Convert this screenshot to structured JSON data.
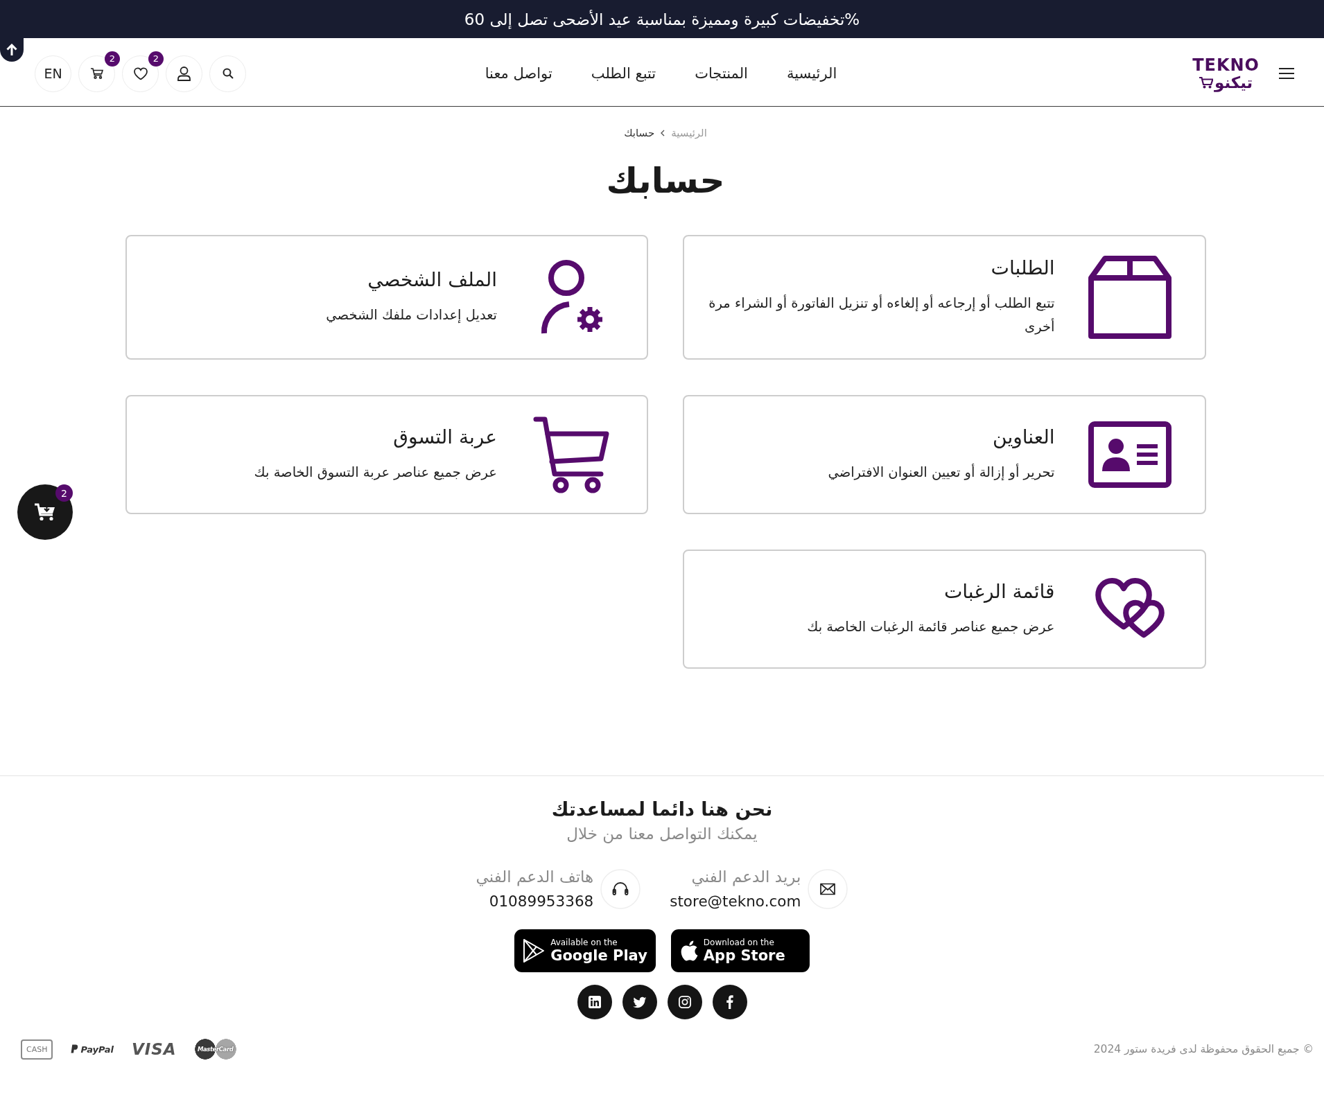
{
  "announcement": "تخفيضات كبيرة ومميزة بمناسبة عيد الأضحى تصل إلى 60%",
  "header": {
    "logo": {
      "latin": "TEKNO",
      "arabic": "تيكنو"
    },
    "nav": [
      "الرئيسية",
      "المنتجات",
      "تتبع الطلب",
      "تواصل معنا"
    ],
    "wishlist_count": "2",
    "cart_count": "2",
    "language": "EN"
  },
  "breadcrumb": {
    "home": "الرئيسية",
    "current": "حسابك"
  },
  "title": "حسابك",
  "cards": [
    {
      "kind": "orders",
      "title": "الطلبات",
      "description": "تتبع الطلب أو إرجاعه أو إلغاءه أو تنزيل الفاتورة أو الشراء مرة أخرى"
    },
    {
      "kind": "profile",
      "title": "الملف الشخصي",
      "description": "تعديل إعدادات ملفك الشخصي"
    },
    {
      "kind": "addresses",
      "title": "العناوين",
      "description": "تحرير أو إزالة أو تعيين العنوان الافتراضي"
    },
    {
      "kind": "cart",
      "title": "عربة التسوق",
      "description": "عرض جميع عناصر عربة التسوق الخاصة بك"
    },
    {
      "kind": "wishlist",
      "title": "قائمة الرغبات",
      "description": "عرض جميع عناصر قائمة الرغبات الخاصة بك"
    }
  ],
  "floating_cart": {
    "count": "2"
  },
  "footer": {
    "heading": "نحن هنا دائما لمساعدتك",
    "subtitle": "يمكنك التواصل معنا من خلال",
    "contacts": [
      {
        "kind": "email",
        "label": "بريد الدعم الفني",
        "value": "store@tekno.com"
      },
      {
        "kind": "phone",
        "label": "هاتف الدعم الفني",
        "value": "01089953368"
      }
    ],
    "app_badges": [
      {
        "kind": "app-store",
        "caption": "Download on the",
        "store": "App Store"
      },
      {
        "kind": "google-play",
        "caption": "Available on the",
        "store": "Google Play"
      }
    ],
    "copyright": "© جميع الحقوق محفوظة لدى فريدة ستور 2024",
    "payment_methods": [
      {
        "kind": "mastercard",
        "label": "MasterCard"
      },
      {
        "kind": "visa",
        "label": "VISA"
      },
      {
        "kind": "paypal",
        "label": "PayPal"
      },
      {
        "kind": "cash",
        "label": "CASH"
      }
    ]
  }
}
